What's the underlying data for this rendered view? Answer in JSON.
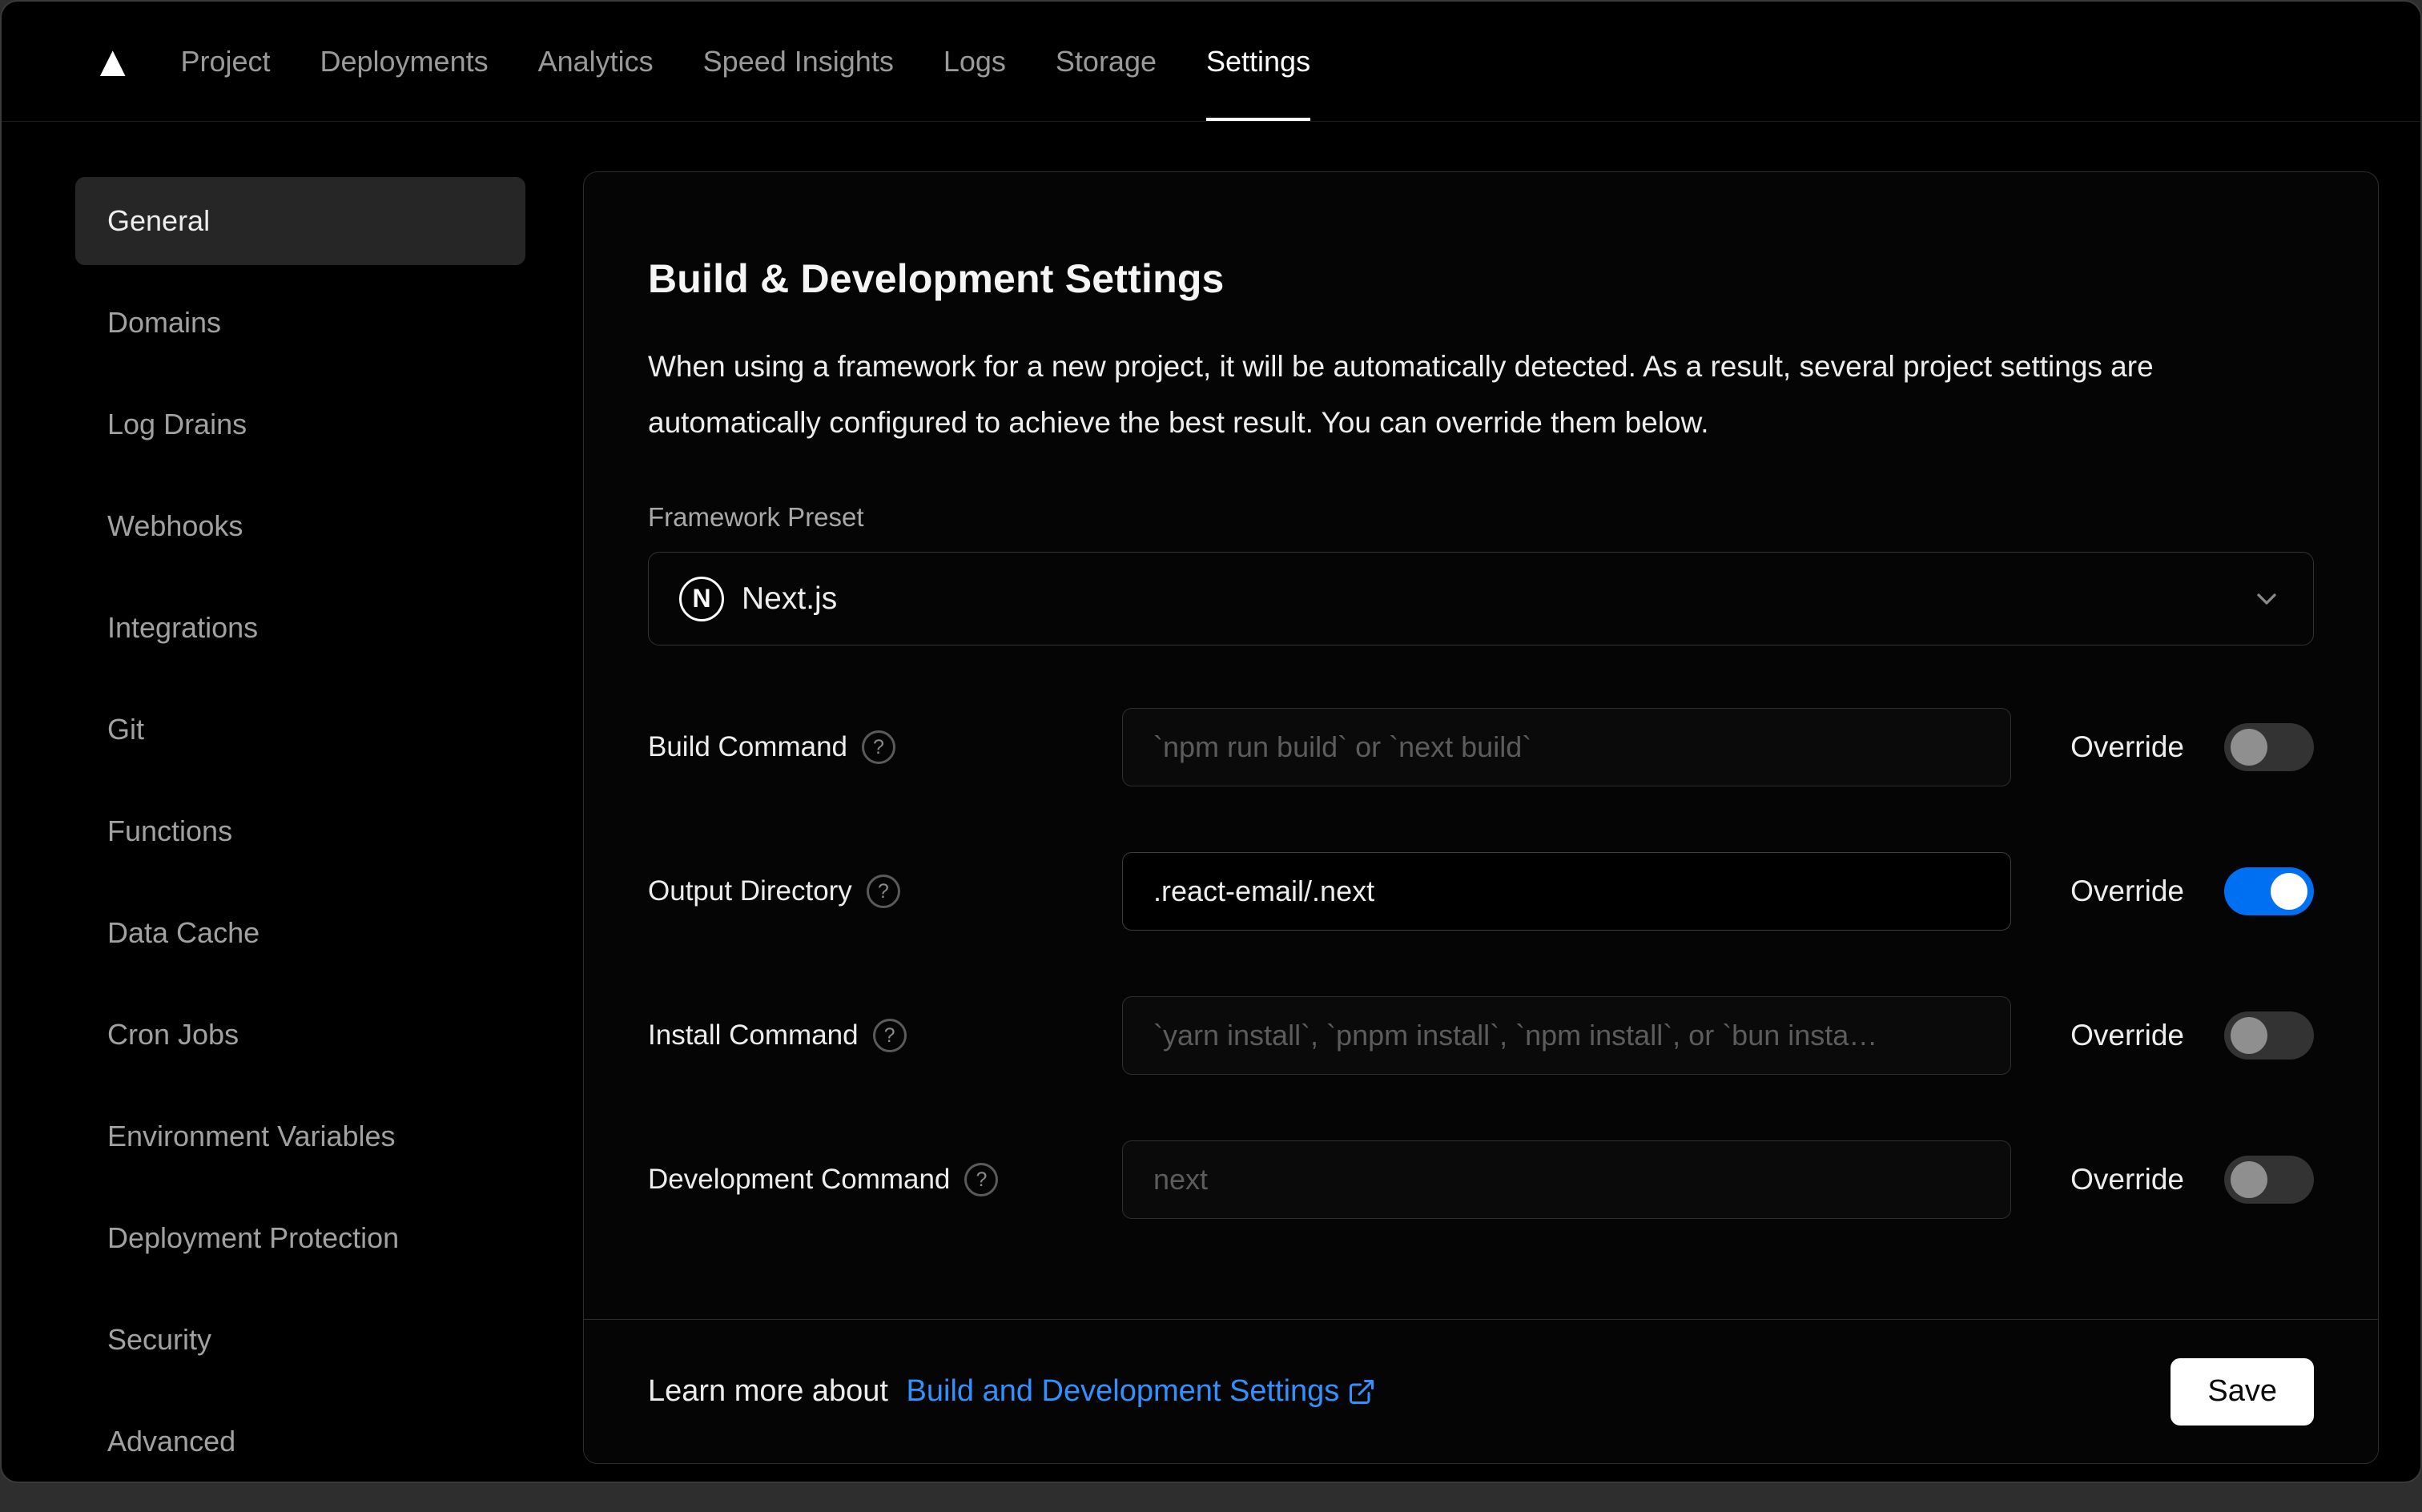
{
  "nav": {
    "items": [
      {
        "label": "Project"
      },
      {
        "label": "Deployments"
      },
      {
        "label": "Analytics"
      },
      {
        "label": "Speed Insights"
      },
      {
        "label": "Logs"
      },
      {
        "label": "Storage"
      },
      {
        "label": "Settings",
        "active": true
      }
    ]
  },
  "sidebar": {
    "items": [
      {
        "label": "General",
        "active": true
      },
      {
        "label": "Domains"
      },
      {
        "label": "Log Drains"
      },
      {
        "label": "Webhooks"
      },
      {
        "label": "Integrations"
      },
      {
        "label": "Git"
      },
      {
        "label": "Functions"
      },
      {
        "label": "Data Cache"
      },
      {
        "label": "Cron Jobs"
      },
      {
        "label": "Environment Variables"
      },
      {
        "label": "Deployment Protection"
      },
      {
        "label": "Security"
      },
      {
        "label": "Advanced"
      }
    ]
  },
  "panel": {
    "title": "Build & Development Settings",
    "description": "When using a framework for a new project, it will be automatically detected. As a result, several project settings are automatically configured to achieve the best result. You can override them below.",
    "framework": {
      "label": "Framework Preset",
      "value": "Next.js"
    },
    "rows": [
      {
        "label": "Build Command",
        "placeholder": "`npm run build` or `next build`",
        "value": "",
        "override_label": "Override",
        "toggle_on": false
      },
      {
        "label": "Output Directory",
        "placeholder": "",
        "value": ".react-email/.next",
        "override_label": "Override",
        "toggle_on": true
      },
      {
        "label": "Install Command",
        "placeholder": "`yarn install`, `pnpm install`, `npm install`, or `bun insta…",
        "value": "",
        "override_label": "Override",
        "toggle_on": false
      },
      {
        "label": "Development Command",
        "placeholder": "next",
        "value": "",
        "override_label": "Override",
        "toggle_on": false
      }
    ],
    "footer": {
      "learn_text": "Learn more about ",
      "link_label": "Build and Development Settings",
      "save_label": "Save"
    }
  },
  "icons": {
    "vercel_logo": "▲",
    "nextjs_logo": "N",
    "help": "?"
  },
  "colors": {
    "accent_blue": "#0070f3",
    "link_blue": "#3291ff",
    "save_button_bg": "#ffffff"
  }
}
